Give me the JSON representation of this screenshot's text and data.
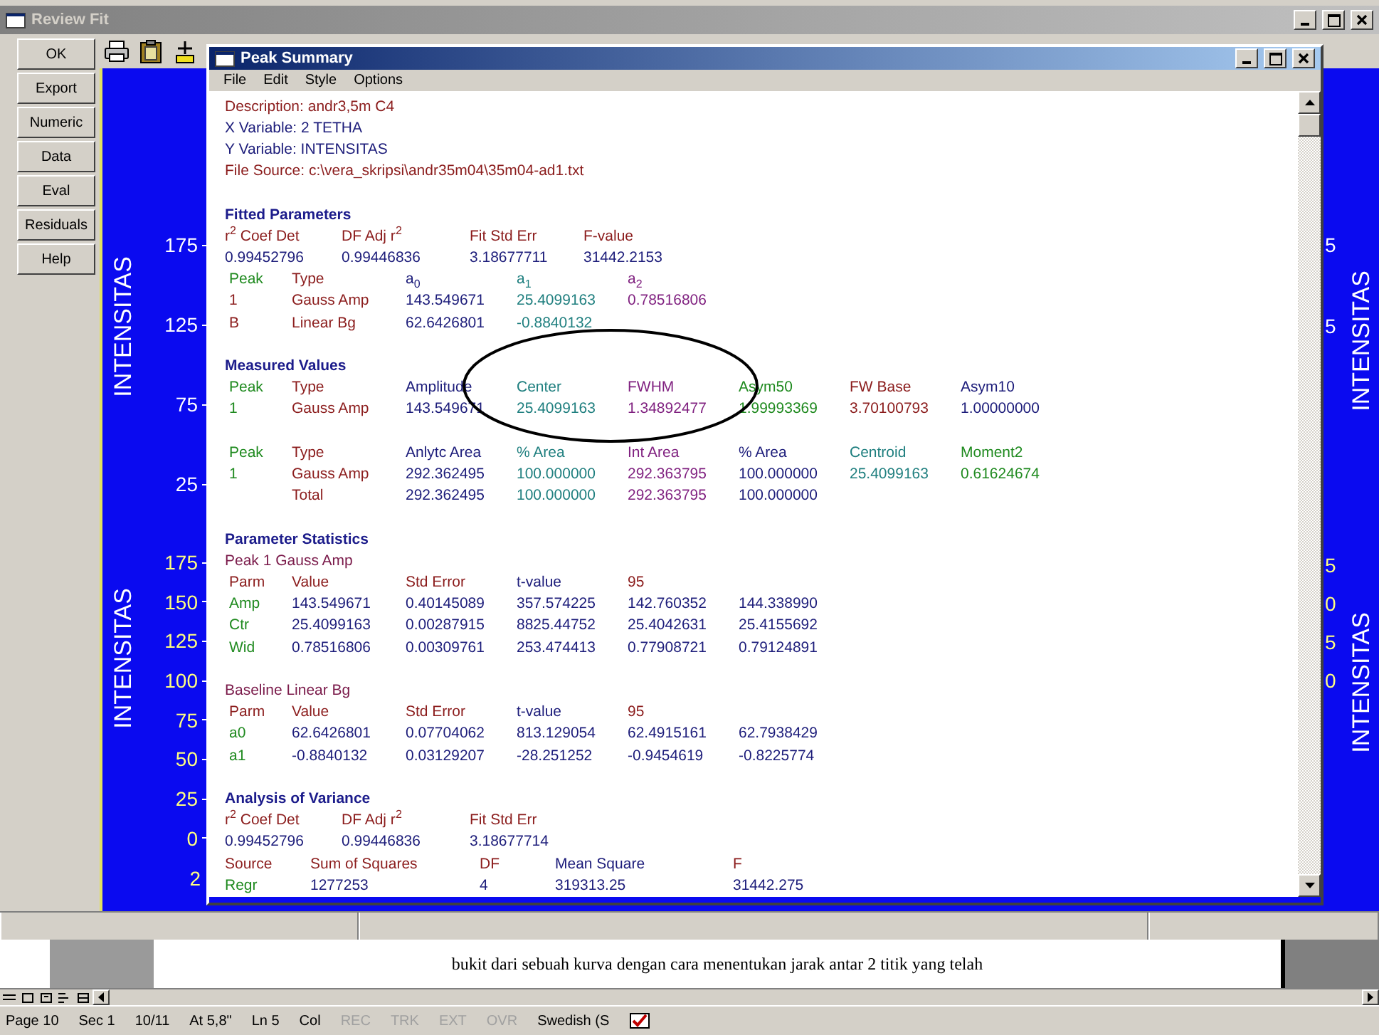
{
  "window": {
    "title": "Review Fit"
  },
  "side_buttons": [
    "OK",
    "Export",
    "Numeric",
    "Data",
    "Eval",
    "Residuals",
    "Help"
  ],
  "plot": {
    "left_axes": [
      {
        "label": "INTENSITAS",
        "color": "#ffffff",
        "ticks": [
          "175",
          "125",
          "75",
          "25"
        ]
      },
      {
        "label": "INTENSITAS",
        "color": "#ffff80",
        "ticks": [
          "175",
          "150",
          "125",
          "100",
          "75",
          "50",
          "25",
          "0"
        ],
        "x_tick": "2"
      }
    ],
    "right_axes": [
      {
        "label": "INTENSITAS",
        "color": "#ffffff",
        "ticks": [
          "5",
          "5"
        ]
      },
      {
        "label": "INTENSITAS",
        "color": "#ffff80",
        "ticks": [
          "5",
          "0",
          "5",
          "0"
        ]
      }
    ]
  },
  "summary": {
    "title": "Peak Summary",
    "menu": [
      "File",
      "Edit",
      "Style",
      "Options"
    ],
    "description": [
      {
        "text": "Description: andr3,5m C4",
        "color": "#8b1c1c"
      },
      {
        "text": "X Variable: 2 TETHA",
        "color": "#1c1c7a"
      },
      {
        "text": "Y Variable: INTENSITAS",
        "color": "#1c1c7a"
      },
      {
        "text": "File Source: c:\\vera_skripsi\\andr35m04\\35m04-ad1.txt",
        "color": "#8b1c1c"
      }
    ],
    "sections": [
      {
        "heading": "Fitted Parameters",
        "tables": [
          {
            "kind": "fit",
            "header_columns": [
              {
                "color": "#8b1c1c"
              },
              {
                "color": "#8b1c1c"
              },
              {
                "color": "#8b1c1c"
              },
              {
                "color": "#8b1c1c"
              }
            ],
            "columns": [
              {
                "color": "#1c1c7a"
              },
              {
                "color": "#1c1c7a"
              },
              {
                "color": "#1c1c7a"
              },
              {
                "color": "#1c1c7a"
              }
            ],
            "rows": [
              {
                "kind": "header",
                "cells": [
                  "r$^{2}$ Coef Det",
                  "DF Adj r$^{2}$",
                  "Fit Std Err",
                  "F-value"
                ]
              },
              {
                "kind": "data",
                "cells": [
                  "0.99452796",
                  "0.99446836",
                  "3.18677711",
                  "31442.2153"
                ]
              }
            ]
          },
          {
            "kind": "stats",
            "header_columns": [
              {
                "color": "#1f8a1f"
              },
              {
                "color": "#8b1c1c"
              },
              {
                "color": "#1c1c7a"
              },
              {
                "color": "#1f7f7f"
              },
              {
                "color": "#7f1f7f"
              }
            ],
            "columns": [
              {
                "color": "#8b1c1c"
              },
              {
                "color": "#8b1c1c"
              },
              {
                "color": "#1c1c7a"
              },
              {
                "color": "#1f7f7f"
              },
              {
                "color": "#7f1f7f"
              }
            ],
            "rows": [
              {
                "kind": "header",
                "cells": [
                  "Peak",
                  "Type",
                  "a$_{0}$",
                  "a$_{1}$",
                  "a$_{2}$"
                ]
              },
              {
                "kind": "data",
                "cells": [
                  "1",
                  "Gauss Amp",
                  "143.549671",
                  "25.4099163",
                  "0.78516806"
                ]
              },
              {
                "kind": "data",
                "cells": [
                  "B",
                  "Linear Bg",
                  "62.6426801",
                  "-0.8840132",
                  null
                ]
              }
            ]
          }
        ]
      },
      {
        "heading": "Measured Values",
        "tables": [
          {
            "kind": "stats",
            "columns": [
              {
                "color": "#1f8a1f"
              },
              {
                "color": "#8b1c1c"
              },
              {
                "color": "#1c1c7a"
              },
              {
                "color": "#1f7f7f"
              },
              {
                "color": "#7f1f7f"
              },
              {
                "color": "#1f8a1f"
              },
              {
                "color": "#8b1c1c"
              },
              {
                "color": "#1c1c7a"
              }
            ],
            "rows": [
              {
                "kind": "header",
                "cells": [
                  "Peak",
                  "Type",
                  "Amplitude",
                  "Center",
                  "FWHM",
                  "Asym50",
                  "FW Base",
                  "Asym10"
                ]
              },
              {
                "kind": "data",
                "cells": [
                  "1",
                  "Gauss Amp",
                  "143.549671",
                  "25.4099163",
                  "1.34892477",
                  "1.99993369",
                  "3.70100793",
                  "1.00000000"
                ]
              }
            ]
          },
          {
            "kind": "stats",
            "columns": [
              {
                "color": "#1f8a1f"
              },
              {
                "color": "#8b1c1c"
              },
              {
                "color": "#1c1c7a"
              },
              {
                "color": "#1f7f7f"
              },
              {
                "color": "#7f1f7f"
              },
              {
                "color": "#1c1c7a"
              },
              {
                "color": "#1f7f7f"
              },
              {
                "color": "#1f8a1f"
              }
            ],
            "rows": [
              {
                "kind": "header",
                "cells": [
                  "Peak",
                  "Type",
                  "Anlytc Area",
                  "% Area",
                  "Int Area",
                  "% Area",
                  "Centroid",
                  "Moment2"
                ]
              },
              {
                "kind": "data",
                "cells": [
                  "1",
                  "Gauss Amp",
                  "292.362495",
                  "100.000000",
                  "292.363795",
                  "100.000000",
                  "25.4099163",
                  "0.61624674"
                ]
              },
              {
                "kind": "data",
                "cells": [
                  null,
                  "Total",
                  "292.362495",
                  "100.000000",
                  "292.363795",
                  "100.000000"
                ]
              }
            ]
          }
        ]
      },
      {
        "heading": "Parameter Statistics",
        "tables": [
          {
            "kind": "caption",
            "columns": [
              {
                "color": "#7a1a4a"
              }
            ],
            "rows": [
              {
                "kind": "data",
                "cells": [
                  "Peak 1  Gauss Amp"
                ]
              }
            ]
          },
          {
            "kind": "stats",
            "header_columns": [
              {
                "color": "#8b1c1c"
              },
              {
                "color": "#8b1c1c"
              },
              {
                "color": "#8b1c1c"
              },
              {
                "color": "#1c1c7a"
              },
              {
                "color": "#8b1c1c"
              }
            ],
            "columns": [
              {
                "color": "#1f8a1f"
              },
              {
                "color": "#1c1c7a"
              },
              {
                "color": "#1c1c7a"
              },
              {
                "color": "#1c1c7a"
              },
              {
                "color": "#1c1c7a"
              },
              {
                "color": "#1c1c7a"
              }
            ],
            "rows": [
              {
                "kind": "header",
                "cells": [
                  "Parm",
                  "Value",
                  "Std Error",
                  "t-value",
                  "95"
                ]
              },
              {
                "kind": "data",
                "cells": [
                  "Amp",
                  "143.549671",
                  "0.40145089",
                  "357.574225",
                  "142.760352",
                  "144.338990"
                ]
              },
              {
                "kind": "data",
                "cells": [
                  "Ctr",
                  "25.4099163",
                  "0.00287915",
                  "8825.44752",
                  "25.4042631",
                  "25.4155692"
                ]
              },
              {
                "kind": "data",
                "cells": [
                  "Wid",
                  "0.78516806",
                  "0.00309761",
                  "253.474413",
                  "0.77908721",
                  "0.79124891"
                ]
              }
            ]
          },
          {
            "kind": "caption",
            "columns": [
              {
                "color": "#7a1a4a"
              }
            ],
            "rows": [
              {
                "kind": "data",
                "cells": [
                  "Baseline  Linear Bg"
                ]
              }
            ]
          },
          {
            "kind": "stats",
            "header_columns": [
              {
                "color": "#8b1c1c"
              },
              {
                "color": "#8b1c1c"
              },
              {
                "color": "#8b1c1c"
              },
              {
                "color": "#1c1c7a"
              },
              {
                "color": "#8b1c1c"
              }
            ],
            "columns": [
              {
                "color": "#1f8a1f"
              },
              {
                "color": "#1c1c7a"
              },
              {
                "color": "#1c1c7a"
              },
              {
                "color": "#1c1c7a"
              },
              {
                "color": "#1c1c7a"
              },
              {
                "color": "#1c1c7a"
              }
            ],
            "rows": [
              {
                "kind": "header",
                "cells": [
                  "Parm",
                  "Value",
                  "Std Error",
                  "t-value",
                  "95"
                ]
              },
              {
                "kind": "data",
                "cells": [
                  "a0",
                  "62.6426801",
                  "0.07704062",
                  "813.129054",
                  "62.4915161",
                  "62.7938429"
                ]
              },
              {
                "kind": "data",
                "cells": [
                  "a1",
                  "-0.8840132",
                  "0.03129207",
                  "-28.251252",
                  "-0.9454619",
                  "-0.8225774"
                ]
              }
            ]
          }
        ]
      },
      {
        "heading": "Analysis of Variance",
        "tables": [
          {
            "kind": "fit",
            "header_columns": [
              {
                "color": "#8b1c1c"
              },
              {
                "color": "#8b1c1c"
              },
              {
                "color": "#8b1c1c"
              }
            ],
            "columns": [
              {
                "color": "#1c1c7a"
              },
              {
                "color": "#1c1c7a"
              },
              {
                "color": "#1c1c7a"
              }
            ],
            "rows": [
              {
                "kind": "header",
                "cells": [
                  "r$^{2}$ Coef Det",
                  "DF Adj r$^{2}$",
                  "Fit Std Err"
                ]
              },
              {
                "kind": "data",
                "cells": [
                  "0.99452796",
                  "0.99446836",
                  "3.18677714"
                ]
              }
            ]
          },
          {
            "kind": "anova",
            "header_columns": [
              {
                "color": "#8b1c1c"
              },
              {
                "color": "#8b1c1c"
              },
              {
                "color": "#8b1c1c"
              },
              {
                "color": "#1c1c7a"
              },
              {
                "color": "#8b1c1c"
              }
            ],
            "columns": [
              {
                "color": "#1f8a1f"
              },
              {
                "color": "#1c1c7a"
              },
              {
                "color": "#1c1c7a"
              },
              {
                "color": "#1c1c7a"
              },
              {
                "color": "#1c1c7a"
              }
            ],
            "rows": [
              {
                "kind": "header",
                "cells": [
                  "Source",
                  "Sum of Squares",
                  "DF",
                  "Mean Square",
                  "F"
                ]
              },
              {
                "kind": "data",
                "cells": [
                  "Regr",
                  "1277253",
                  "4",
                  "319313.25",
                  "31442.275"
                ]
              }
            ]
          }
        ]
      }
    ]
  },
  "document": {
    "text": "bukit dari sebuah kurva dengan cara menentukan jarak antar 2 titik yang telah"
  },
  "status_bar": [
    {
      "text": "Page 10",
      "disabled": false
    },
    {
      "text": "Sec 1",
      "disabled": false
    },
    {
      "text": "10/11",
      "disabled": false
    },
    {
      "text": "At 5,8\"",
      "disabled": false
    },
    {
      "text": "Ln 5",
      "disabled": false
    },
    {
      "text": "Col",
      "disabled": false
    },
    {
      "text": "REC",
      "disabled": true
    },
    {
      "text": "TRK",
      "disabled": true
    },
    {
      "text": "EXT",
      "disabled": true
    },
    {
      "text": "OVR",
      "disabled": true
    },
    {
      "text": "Swedish (S",
      "disabled": false
    }
  ]
}
